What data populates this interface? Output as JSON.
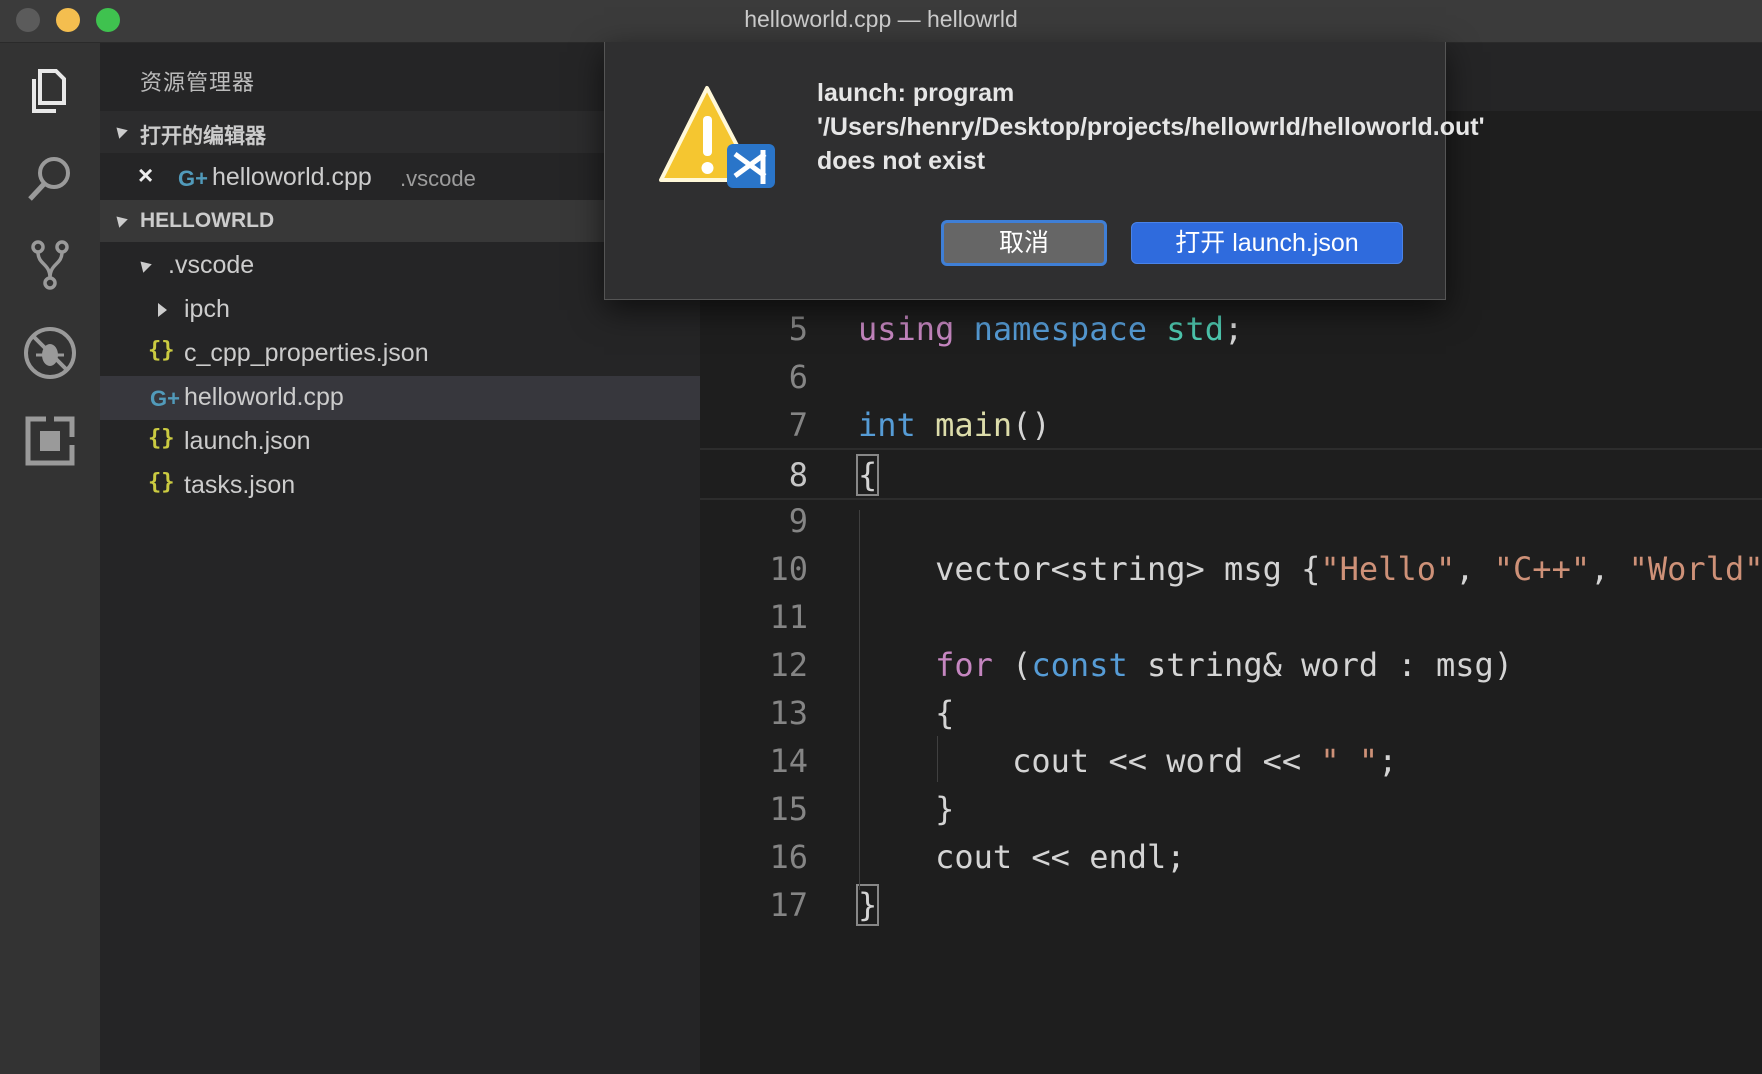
{
  "window": {
    "title": "helloworld.cpp — hellowrld"
  },
  "sidebar": {
    "title": "资源管理器",
    "open_editors_label": "打开的编辑器",
    "open_editor_file": "helloworld.cpp",
    "open_editor_folder": ".vscode",
    "project_label": "HELLOWRLD",
    "tree": [
      {
        "name": ".vscode",
        "type": "folder-open"
      },
      {
        "name": "ipch",
        "type": "folder-closed"
      },
      {
        "name": "c_cpp_properties.json",
        "type": "json"
      },
      {
        "name": "helloworld.cpp",
        "type": "cpp"
      },
      {
        "name": "launch.json",
        "type": "json"
      },
      {
        "name": "tasks.json",
        "type": "json"
      }
    ],
    "json_icon_text": "{}",
    "cpp_icon_text": "G+"
  },
  "editor": {
    "lines": [
      {
        "num": "5",
        "tokens": [
          [
            "kw-purple",
            "using"
          ],
          [
            "",
            " "
          ],
          [
            "kw-blue",
            "namespace"
          ],
          [
            "",
            " "
          ],
          [
            "type",
            "std"
          ],
          [
            "",
            ";"
          ]
        ]
      },
      {
        "num": "6",
        "tokens": []
      },
      {
        "num": "7",
        "tokens": [
          [
            "kw-blue",
            "int"
          ],
          [
            "",
            " "
          ],
          [
            "fn",
            "main"
          ],
          [
            "",
            "()"
          ]
        ]
      },
      {
        "num": "8",
        "tokens": [
          [
            "bracket",
            "{"
          ]
        ]
      },
      {
        "num": "9",
        "tokens": []
      },
      {
        "num": "10",
        "tokens": [
          [
            "",
            "    vector<string> msg {"
          ],
          [
            "str",
            "\"Hello\""
          ],
          [
            "",
            ", "
          ],
          [
            "str",
            "\"C++\""
          ],
          [
            "",
            ", "
          ],
          [
            "str",
            "\"World\""
          ]
        ]
      },
      {
        "num": "11",
        "tokens": []
      },
      {
        "num": "12",
        "tokens": [
          [
            "",
            "    "
          ],
          [
            "kw-purple",
            "for"
          ],
          [
            "",
            " ("
          ],
          [
            "kw-blue",
            "const"
          ],
          [
            "",
            " string& word : msg)"
          ]
        ]
      },
      {
        "num": "13",
        "tokens": [
          [
            "",
            "    {"
          ]
        ]
      },
      {
        "num": "14",
        "tokens": [
          [
            "",
            "        cout << word << "
          ],
          [
            "str",
            "\" \""
          ],
          [
            "",
            ";"
          ]
        ]
      },
      {
        "num": "15",
        "tokens": [
          [
            "",
            "    }"
          ]
        ]
      },
      {
        "num": "16",
        "tokens": [
          [
            "",
            "    cout << endl;"
          ]
        ]
      },
      {
        "num": "17",
        "tokens": [
          [
            "bracket",
            "}"
          ]
        ]
      }
    ],
    "active_line": "8"
  },
  "dialog": {
    "message": "launch: program '/Users/henry/Desktop/projects/hellowrld/helloworld.out' does not exist",
    "cancel_label": "取消",
    "open_label": "打开 launch.json"
  }
}
